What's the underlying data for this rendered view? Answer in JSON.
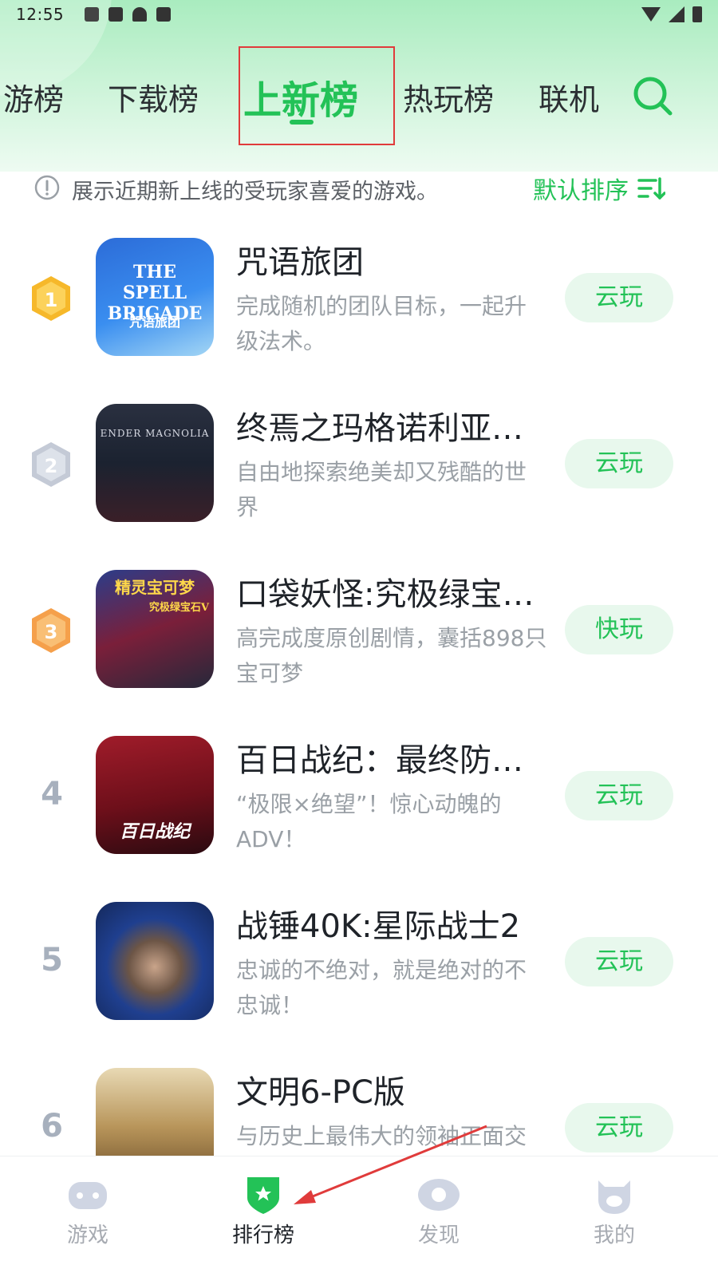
{
  "status_bar": {
    "time": "12:55"
  },
  "tabs": [
    {
      "label": "游榜"
    },
    {
      "label": "下载榜"
    },
    {
      "label": "上新榜"
    },
    {
      "label": "热玩榜"
    },
    {
      "label": "联机"
    }
  ],
  "info": {
    "text": "展示近期新上线的受玩家喜爱的游戏。",
    "sort_label": "默认排序"
  },
  "games": [
    {
      "rank": "1",
      "title": "咒语旅团",
      "desc": "完成随机的团队目标，一起升级法术。",
      "button": "云玩",
      "icon_text": "THE SPELL BRIGADE",
      "icon_sub": "咒语旅团"
    },
    {
      "rank": "2",
      "title": "终焉之玛格诺利亚：…",
      "desc": "自由地探索绝美却又残酷的世界",
      "button": "云玩",
      "icon_text": "ENDER MAGNOLIA"
    },
    {
      "rank": "3",
      "title": "口袋妖怪:究极绿宝石…",
      "desc": "高完成度原创剧情，囊括898只宝可梦",
      "button": "快玩",
      "icon_text": "精灵宝可梦",
      "icon_sub": "究极绿宝石V"
    },
    {
      "rank": "4",
      "title": "百日战纪：最终防卫…",
      "desc": "“极限×绝望”！惊心动魄的ADV！",
      "button": "云玩",
      "icon_text": "百日战纪"
    },
    {
      "rank": "5",
      "title": "战锤40K:星际战士2",
      "desc": "忠诚的不绝对，就是绝对的不忠诚！",
      "button": "云玩"
    },
    {
      "rank": "6",
      "title": "文明6-PC版",
      "desc": "与历史上最伟大的领袖正面交",
      "button": "云玩"
    }
  ],
  "bottom_nav": [
    {
      "label": "游戏"
    },
    {
      "label": "排行榜"
    },
    {
      "label": "发现"
    },
    {
      "label": "我的"
    }
  ],
  "colors": {
    "accent": "#23c257",
    "button_bg": "#e8f8ed",
    "highlight": "#e03b3b",
    "gold": "#f6b82a",
    "silver": "#c4cad6",
    "bronze": "#f5a04b"
  }
}
